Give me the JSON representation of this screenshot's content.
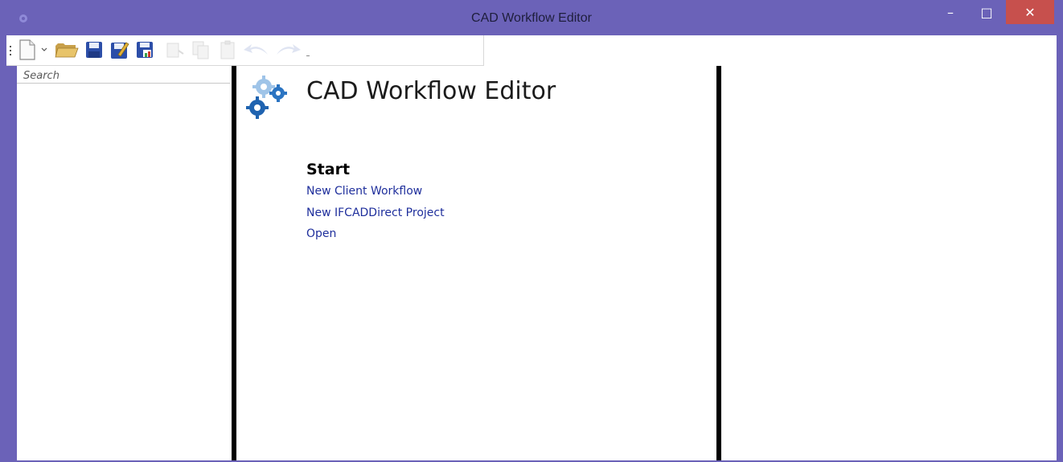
{
  "window": {
    "title": "CAD Workflow Editor",
    "controls": {
      "minimize": "–",
      "maximize": "□",
      "close": "✕"
    }
  },
  "toolbar": {
    "items": [
      {
        "name": "new-document",
        "icon": "new-document-icon",
        "enabled": true
      },
      {
        "name": "new-dropdown",
        "icon": "chevron-down-icon",
        "enabled": true
      },
      {
        "name": "open",
        "icon": "folder-icon",
        "enabled": true
      },
      {
        "name": "save",
        "icon": "floppy-icon",
        "enabled": true
      },
      {
        "name": "save-as",
        "icon": "floppy-pencil-icon",
        "enabled": true
      },
      {
        "name": "save-all",
        "icon": "floppy-chart-icon",
        "enabled": true
      },
      {
        "name": "cut",
        "icon": "cut-icon",
        "enabled": false
      },
      {
        "name": "copy",
        "icon": "copy-icon",
        "enabled": false
      },
      {
        "name": "paste",
        "icon": "paste-icon",
        "enabled": false
      },
      {
        "name": "undo",
        "icon": "undo-arrow-icon",
        "enabled": false
      },
      {
        "name": "redo",
        "icon": "redo-arrow-icon",
        "enabled": false
      },
      {
        "name": "overflow",
        "icon": "overflow-icon",
        "enabled": true
      }
    ]
  },
  "search": {
    "placeholder": "Search",
    "value": ""
  },
  "start_page": {
    "title": "CAD Workflow Editor",
    "section_heading": "Start",
    "links": [
      {
        "label": "New Client Workflow"
      },
      {
        "label": "New IFCADDirect Project"
      },
      {
        "label": "Open"
      }
    ]
  },
  "colors": {
    "window_frame": "#6b62b8",
    "close_button": "#c7504d",
    "link": "#1f2f9c",
    "splitter": "#000000"
  }
}
